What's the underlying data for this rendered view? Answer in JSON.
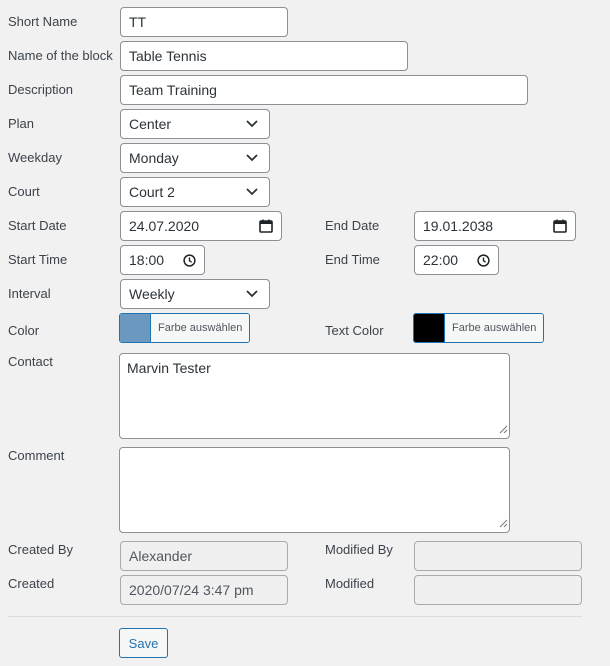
{
  "fields": {
    "short_name": {
      "label": "Short Name",
      "value": "TT"
    },
    "block_name": {
      "label": "Name of the block",
      "value": "Table Tennis"
    },
    "description": {
      "label": "Description",
      "value": "Team Training"
    },
    "plan": {
      "label": "Plan",
      "value": "Center"
    },
    "weekday": {
      "label": "Weekday",
      "value": "Monday"
    },
    "court": {
      "label": "Court",
      "value": "Court 2"
    },
    "start_date": {
      "label": "Start Date",
      "value": "24.07.2020"
    },
    "end_date": {
      "label": "End Date",
      "value": "19.01.2038"
    },
    "start_time": {
      "label": "Start Time",
      "value": "18:00"
    },
    "end_time": {
      "label": "End Time",
      "value": "22:00"
    },
    "interval": {
      "label": "Interval",
      "value": "Weekly"
    },
    "color": {
      "label": "Color",
      "button": "Farbe auswählen",
      "swatch": "#6b98bf"
    },
    "text_color": {
      "label": "Text Color",
      "button": "Farbe auswählen",
      "swatch": "#000000"
    },
    "contact": {
      "label": "Contact",
      "value": "Marvin Tester"
    },
    "comment": {
      "label": "Comment",
      "value": ""
    },
    "created_by": {
      "label": "Created By",
      "value": "Alexander"
    },
    "modified_by": {
      "label": "Modified By",
      "value": ""
    },
    "created": {
      "label": "Created",
      "value": "2020/07/24 3:47 pm"
    },
    "modified": {
      "label": "Modified",
      "value": ""
    }
  },
  "actions": {
    "save": "Save"
  },
  "icons": {
    "dropdown": "chevron-down-icon",
    "date": "calendar-icon",
    "time": "clock-icon",
    "resize": "resize-grip-icon"
  }
}
